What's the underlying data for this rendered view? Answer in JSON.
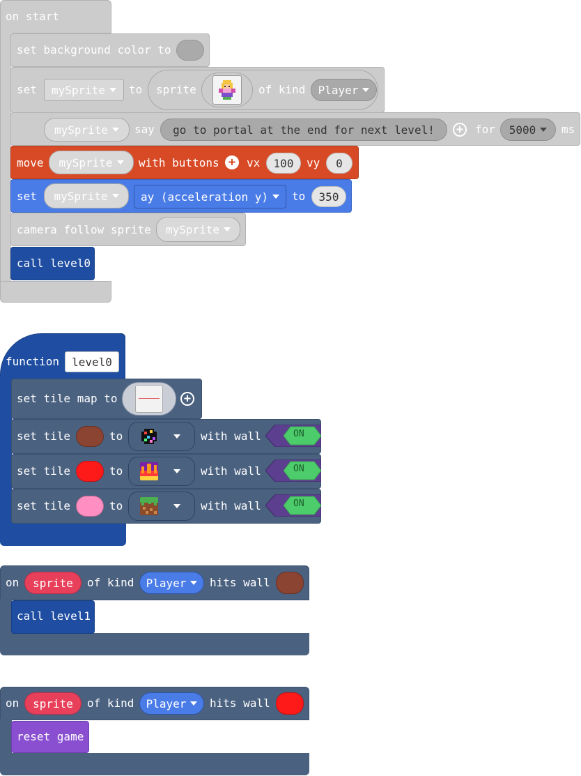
{
  "on_start": {
    "header": "on start",
    "set_bg": {
      "label": "set background color to",
      "color": "#aaaaaa"
    },
    "set_sprite": {
      "set": "set",
      "var": "mySprite",
      "to": "to",
      "sprite": "sprite",
      "of_kind": "of kind",
      "kind": "Player"
    },
    "say": {
      "var": "mySprite",
      "say": "say",
      "text": "go to portal at the end for next level!",
      "for": "for",
      "ms_value": "5000",
      "ms": "ms"
    },
    "move": {
      "move": "move",
      "var": "mySprite",
      "with_buttons": "with buttons",
      "vx": "vx",
      "vx_value": "100",
      "vy": "vy",
      "vy_value": "0"
    },
    "set_ay": {
      "set": "set",
      "var": "mySprite",
      "prop": "ay (acceleration y)",
      "to": "to",
      "value": "350"
    },
    "camera": {
      "label": "camera follow sprite",
      "var": "mySprite"
    },
    "call": {
      "label": "call level0"
    }
  },
  "function_block": {
    "function": "function",
    "name": "level0",
    "set_tilemap": {
      "label": "set tile map to"
    },
    "tiles": [
      {
        "set_tile": "set tile",
        "color": "#8b4332",
        "to": "to",
        "tile_icon": "dark-sparkle-tile-icon",
        "with_wall": "with wall",
        "toggle": "ON"
      },
      {
        "set_tile": "set tile",
        "color": "#ff1a1a",
        "to": "to",
        "tile_icon": "fire-tile-icon",
        "with_wall": "with wall",
        "toggle": "ON"
      },
      {
        "set_tile": "set tile",
        "color": "#ff8fc2",
        "to": "to",
        "tile_icon": "grass-dirt-tile-icon",
        "with_wall": "with wall",
        "toggle": "ON"
      }
    ]
  },
  "hit_wall_1": {
    "on": "on",
    "sprite": "sprite",
    "of_kind": "of kind",
    "kind": "Player",
    "hits_wall": "hits wall",
    "color": "#8b4332",
    "body": "call level1"
  },
  "hit_wall_2": {
    "on": "on",
    "sprite": "sprite",
    "of_kind": "of kind",
    "kind": "Player",
    "hits_wall": "hits wall",
    "color": "#ff1a1a",
    "body": "reset game"
  }
}
